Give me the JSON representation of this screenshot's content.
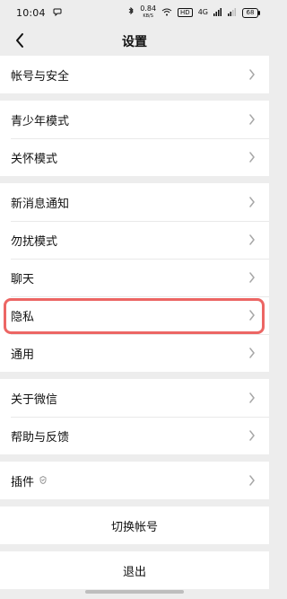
{
  "status_bar": {
    "time": "10:04",
    "speed_top": "0.84",
    "speed_unit": "KB/S",
    "badge": "HD",
    "signal": "4G",
    "battery": "68"
  },
  "header": {
    "title": "设置"
  },
  "groups": [
    {
      "items": [
        {
          "label": "帐号与安全"
        }
      ]
    },
    {
      "items": [
        {
          "label": "青少年模式"
        },
        {
          "label": "关怀模式"
        }
      ]
    },
    {
      "items": [
        {
          "label": "新消息通知"
        },
        {
          "label": "勿扰模式"
        },
        {
          "label": "聊天"
        },
        {
          "label": "隐私"
        },
        {
          "label": "通用"
        }
      ]
    },
    {
      "items": [
        {
          "label": "关于微信"
        },
        {
          "label": "帮助与反馈"
        }
      ]
    },
    {
      "items": [
        {
          "label": "插件"
        }
      ]
    }
  ],
  "actions": {
    "switch_account": "切换帐号",
    "logout": "退出"
  },
  "colors": {
    "highlight": "#ec6664",
    "background": "#ededed",
    "row_bg": "#ffffff"
  }
}
